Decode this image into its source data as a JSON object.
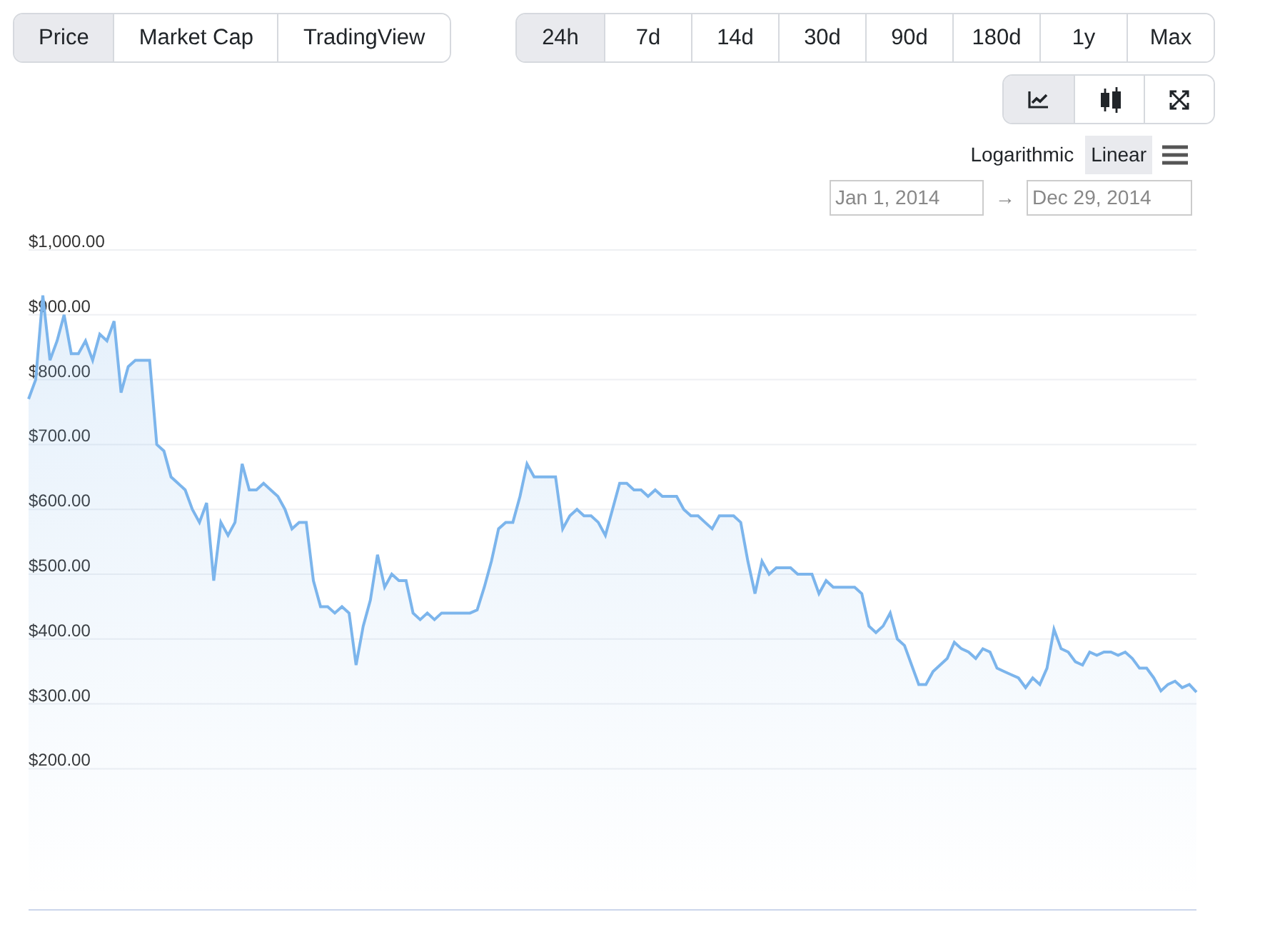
{
  "view_tabs": [
    {
      "label": "Price",
      "selected": true
    },
    {
      "label": "Market Cap",
      "selected": false
    },
    {
      "label": "TradingView",
      "selected": false
    }
  ],
  "ranges": [
    {
      "label": "24h",
      "selected": true
    },
    {
      "label": "7d",
      "selected": false
    },
    {
      "label": "14d",
      "selected": false
    },
    {
      "label": "30d",
      "selected": false
    },
    {
      "label": "90d",
      "selected": false
    },
    {
      "label": "180d",
      "selected": false
    },
    {
      "label": "1y",
      "selected": false
    },
    {
      "label": "Max",
      "selected": false
    }
  ],
  "chart_tools": [
    {
      "kind": "line",
      "selected": true
    },
    {
      "kind": "candlestick",
      "selected": false
    },
    {
      "kind": "fullscreen",
      "selected": false
    }
  ],
  "scale": [
    {
      "label": "Logarithmic",
      "selected": false
    },
    {
      "label": "Linear",
      "selected": true
    }
  ],
  "date_range": {
    "from": "Jan 1, 2014",
    "arrow": "→",
    "to": "Dec 29, 2014"
  },
  "chart": {
    "chart_data": {
      "type": "area",
      "grid": true,
      "ylim": [
        200,
        1000
      ],
      "yticks": [
        {
          "value": 200,
          "label": "$200.00"
        },
        {
          "value": 300,
          "label": "$300.00"
        },
        {
          "value": 400,
          "label": "$400.00"
        },
        {
          "value": 500,
          "label": "$500.00"
        },
        {
          "value": 600,
          "label": "$600.00"
        },
        {
          "value": 700,
          "label": "$700.00"
        },
        {
          "value": 800,
          "label": "$800.00"
        },
        {
          "value": 900,
          "label": "$900.00"
        },
        {
          "value": 1000,
          "label": "$1,000.00"
        }
      ],
      "series": [
        {
          "color": "#7cb5ec",
          "values": [
            770,
            800,
            930,
            830,
            860,
            900,
            840,
            840,
            860,
            830,
            870,
            860,
            890,
            780,
            820,
            830,
            830,
            830,
            700,
            690,
            650,
            640,
            630,
            600,
            580,
            610,
            490,
            580,
            560,
            580,
            670,
            630,
            630,
            640,
            630,
            620,
            600,
            570,
            580,
            580,
            490,
            450,
            450,
            440,
            450,
            440,
            360,
            420,
            460,
            530,
            480,
            500,
            490,
            490,
            440,
            430,
            440,
            430,
            440,
            440,
            440,
            440,
            440,
            445,
            480,
            520,
            570,
            580,
            580,
            620,
            670,
            650,
            650,
            650,
            650,
            570,
            590,
            600,
            590,
            590,
            580,
            560,
            600,
            640,
            640,
            630,
            630,
            620,
            630,
            620,
            620,
            620,
            600,
            590,
            590,
            580,
            570,
            590,
            590,
            590,
            580,
            520,
            470,
            520,
            500,
            510,
            510,
            510,
            500,
            500,
            500,
            470,
            490,
            480,
            480,
            480,
            480,
            470,
            420,
            410,
            420,
            440,
            400,
            390,
            360,
            330,
            330,
            350,
            360,
            370,
            395,
            385,
            380,
            370,
            385,
            380,
            355,
            350,
            345,
            340,
            325,
            340,
            330,
            355,
            415,
            385,
            380,
            365,
            360,
            380,
            375,
            380,
            380,
            375,
            380,
            370,
            355,
            355,
            340,
            320,
            330,
            335,
            325,
            330,
            318
          ]
        }
      ]
    }
  }
}
